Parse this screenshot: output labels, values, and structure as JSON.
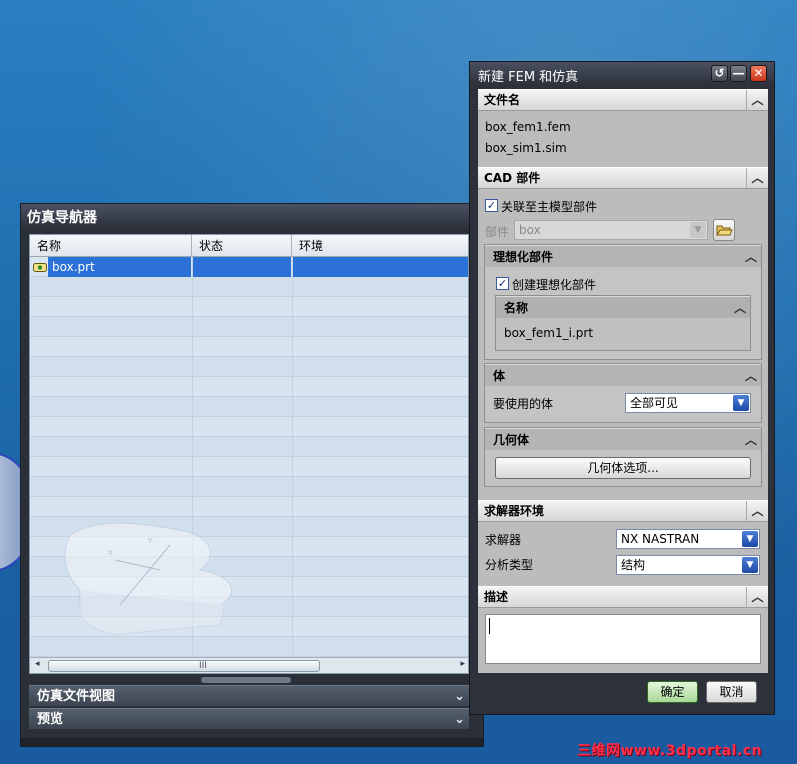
{
  "nav": {
    "title": "仿真导航器",
    "columns": [
      "名称",
      "状态",
      "环境"
    ],
    "selected_row": {
      "name": "box.prt",
      "status": "",
      "environment": ""
    },
    "sections": [
      "仿真文件视图",
      "预览"
    ]
  },
  "dialog": {
    "title": "新建 FEM 和仿真",
    "file_name_section": "文件名",
    "files": [
      "box_fem1.fem",
      "box_sim1.sim"
    ],
    "cad_section": "CAD 部件",
    "associate_label": "关联至主模型部件",
    "associate_checked": true,
    "part_label": "部件",
    "part_value": "box",
    "idealized_section": "理想化部件",
    "create_idealized_label": "创建理想化部件",
    "create_idealized_checked": true,
    "name_header": "名称",
    "idealized_name": "box_fem1_i.prt",
    "body_section": "体",
    "bodies_label": "要使用的体",
    "bodies_value": "全部可见",
    "geometry_section": "几何体",
    "geometry_options_button": "几何体选项...",
    "solver_env_section": "求解器环境",
    "solver_label": "求解器",
    "solver_value": "NX NASTRAN",
    "analysis_label": "分析类型",
    "analysis_value": "结构",
    "description_section": "描述",
    "description_value": "",
    "ok_button": "确定",
    "cancel_button": "取消"
  },
  "watermark": "三维网www.3dportal.cn",
  "icons": {
    "collapse": "chevron-up-icon",
    "expand": "chevron-down-icon",
    "folder": "folder-open-icon",
    "reset": "reset-icon",
    "minimize": "minimize-icon",
    "close": "close-icon",
    "part": "part-file-icon"
  }
}
